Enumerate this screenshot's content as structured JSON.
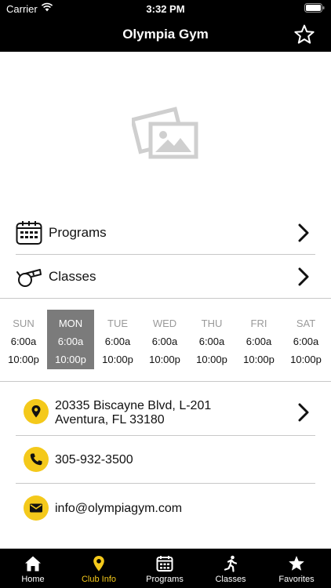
{
  "status_bar": {
    "carrier": "Carrier",
    "time": "3:32 PM"
  },
  "nav": {
    "title": "Olympia Gym"
  },
  "menu": [
    {
      "label": "Programs",
      "icon": "calendar-icon"
    },
    {
      "label": "Classes",
      "icon": "whistle-icon"
    }
  ],
  "hours": {
    "selected_day": "MON",
    "days": [
      {
        "name": "SUN",
        "open": "6:00a",
        "close": "10:00p"
      },
      {
        "name": "MON",
        "open": "6:00a",
        "close": "10:00p"
      },
      {
        "name": "TUE",
        "open": "6:00a",
        "close": "10:00p"
      },
      {
        "name": "WED",
        "open": "6:00a",
        "close": "10:00p"
      },
      {
        "name": "THU",
        "open": "6:00a",
        "close": "10:00p"
      },
      {
        "name": "FRI",
        "open": "6:00a",
        "close": "10:00p"
      },
      {
        "name": "SAT",
        "open": "6:00a",
        "close": "10:00p"
      }
    ]
  },
  "contact": {
    "address_line1": "20335 Biscayne Blvd, L-201",
    "address_line2": "Aventura, FL 33180",
    "phone": "305-932-3500",
    "email": "info@olympiagym.com"
  },
  "tabs": [
    {
      "label": "Home",
      "icon": "home-icon"
    },
    {
      "label": "Club Info",
      "icon": "location-pin-icon"
    },
    {
      "label": "Programs",
      "icon": "calendar-icon"
    },
    {
      "label": "Classes",
      "icon": "running-person-icon"
    },
    {
      "label": "Favorites",
      "icon": "star-icon"
    }
  ],
  "colors": {
    "accent": "#f4c91b",
    "header_bg": "#000000",
    "selected_day_bg": "#7b7b7b"
  }
}
